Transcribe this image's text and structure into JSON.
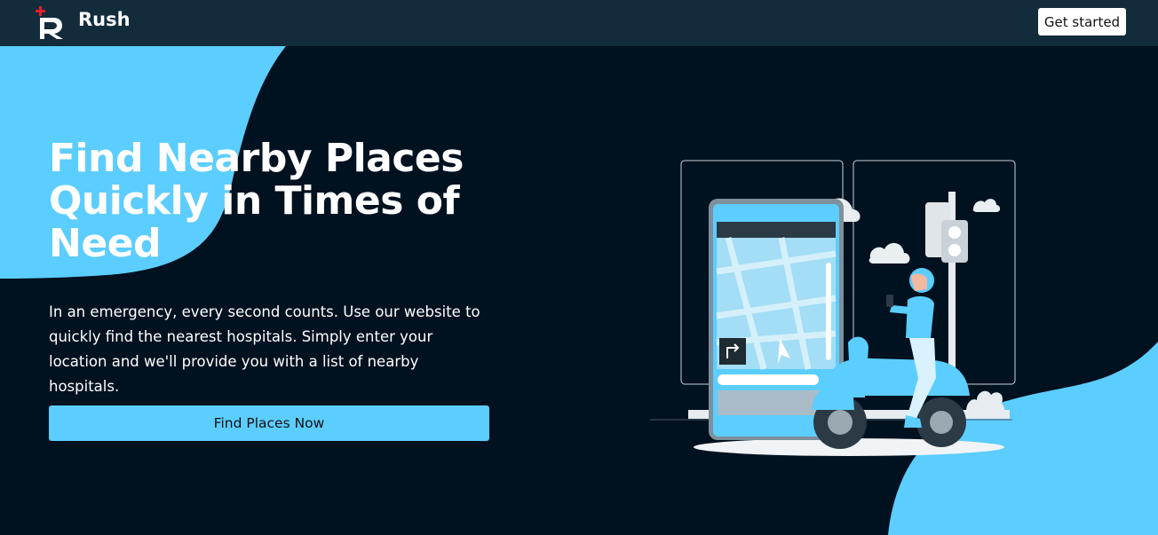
{
  "navbar": {
    "brand": "Rush",
    "get_started_label": "Get started"
  },
  "hero": {
    "title": "Find Nearby Places Quickly in Times of Need",
    "description": "In an emergency, every second counts. Use our website to quickly find the nearest hospitals. Simply enter your location and we'll provide you with a list of nearby hospitals.",
    "cta_label": "Find Places Now"
  },
  "colors": {
    "background": "#00111f",
    "navbar": "#122c3c",
    "accent": "#5ccdff",
    "logo_cross": "#e0202a"
  },
  "icons": [
    "rush-logo-icon",
    "person-on-scooter-illustration"
  ]
}
